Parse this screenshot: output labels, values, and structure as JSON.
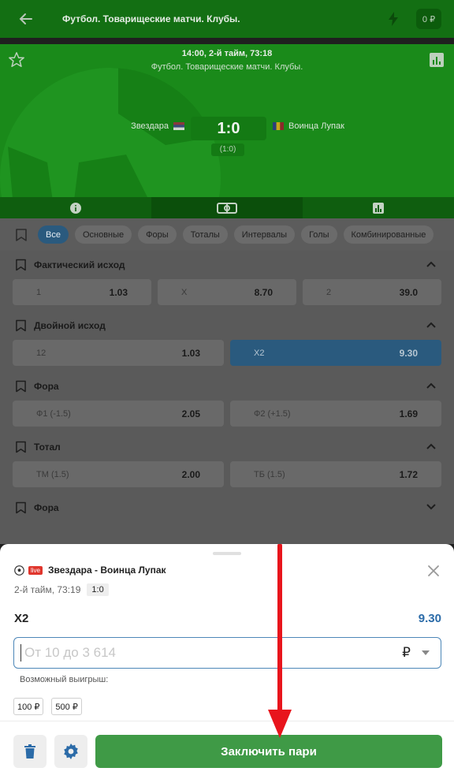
{
  "header": {
    "title": "Футбол. Товарищеские матчи. Клубы.",
    "balance": "0 ₽"
  },
  "scoreboard": {
    "time": "14:00, 2-й тайм, 73:18",
    "league": "Футбол. Товарищеские матчи. Клубы.",
    "home_team": "Звездара",
    "away_team": "Воинца Лупак",
    "score": "1:0",
    "half_score": "(1:0)"
  },
  "filters": {
    "chips": [
      "Все",
      "Основные",
      "Форы",
      "Тоталы",
      "Интервалы",
      "Голы",
      "Комбинированные"
    ],
    "active_index": 0
  },
  "markets": [
    {
      "title": "Фактический исход",
      "odds": [
        {
          "label": "1",
          "value": "1.03"
        },
        {
          "label": "X",
          "value": "8.70"
        },
        {
          "label": "2",
          "value": "39.0"
        }
      ]
    },
    {
      "title": "Двойной исход",
      "odds": [
        {
          "label": "12",
          "value": "1.03"
        },
        {
          "label": "X2",
          "value": "9.30"
        }
      ]
    },
    {
      "title": "Фора",
      "odds": [
        {
          "label": "Ф1 (-1.5)",
          "value": "2.05"
        },
        {
          "label": "Ф2 (+1.5)",
          "value": "1.69"
        }
      ]
    },
    {
      "title": "Тотал",
      "odds": [
        {
          "label": "ТМ (1.5)",
          "value": "2.00"
        },
        {
          "label": "ТБ (1.5)",
          "value": "1.72"
        }
      ]
    },
    {
      "title": "Фора"
    }
  ],
  "betslip": {
    "live_label": "live",
    "event": "Звездара - Воинца Лупак",
    "period": "2-й тайм, 73:19",
    "score": "1:0",
    "bet_name": "X2",
    "bet_odd": "9.30",
    "stake_placeholder": "От 10 до 3 614",
    "currency": "₽",
    "possible_win_label": "Возможный выигрыш:",
    "quick_stakes": [
      "100 ₽",
      "500 ₽"
    ],
    "place_bet_label": "Заключить пари"
  },
  "colors": {
    "brand_green": "#3f9a46",
    "accent_blue": "#2b6ba8",
    "live_red": "#e0362d",
    "annotation_red": "#e8141c"
  }
}
